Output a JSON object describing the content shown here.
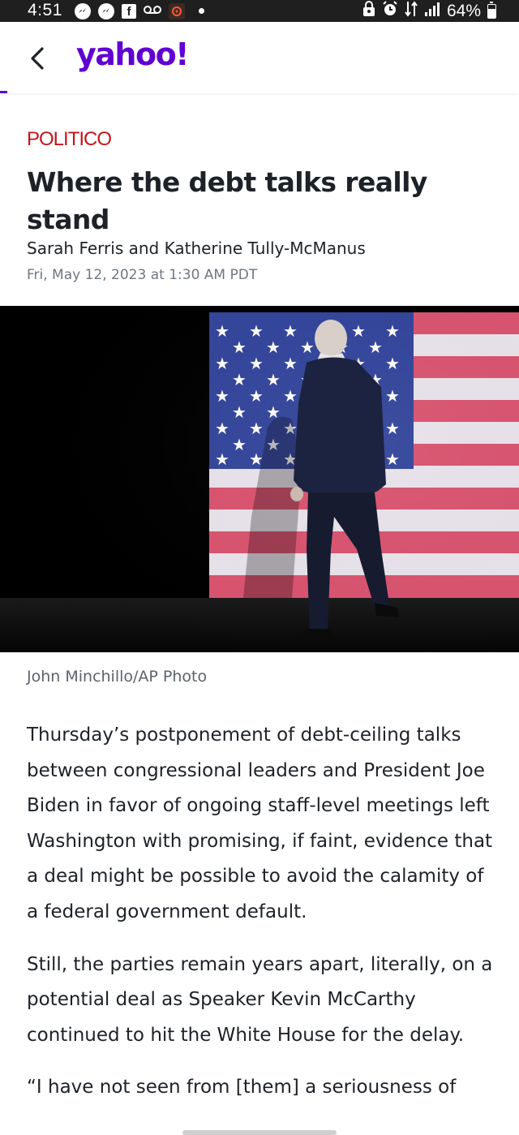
{
  "status_bar": {
    "time": "4:51",
    "battery_percent": "64%",
    "battery_level": 0.64,
    "left_icons": [
      "messenger-icon",
      "messenger-icon",
      "facebook-icon",
      "voicemail-icon",
      "app-icon",
      "notification-dot-icon"
    ],
    "right_icons": [
      "lock-icon",
      "alarm-icon",
      "data-transfer-icon",
      "signal-icon",
      "battery-icon"
    ]
  },
  "header": {
    "logo_text": "yahoo!",
    "logo_color": "#6001d2",
    "back_icon": "chevron-left-icon"
  },
  "article": {
    "source": "POLITICO",
    "source_color": "#c4161c",
    "title": "Where the debt talks really stand",
    "author": "Sarah Ferris and Katherine Tully-McManus",
    "date": "Fri, May 12, 2023 at 1:30 AM PDT",
    "photo_credit": "John Minchillo/AP Photo",
    "paragraphs": [
      "Thursday’s postponement of debt-ceiling talks between congressional leaders and President Joe Biden in favor of ongoing staff-level meetings left Washington with promising, if faint, evidence that a deal might be possible to avoid the calamity of a federal government default.",
      "Still, the parties remain years apart, literally, on a potential deal as Speaker Kevin McCarthy continued to hit the White House for the delay.",
      "“I have not seen from [them] a seriousness of"
    ]
  }
}
